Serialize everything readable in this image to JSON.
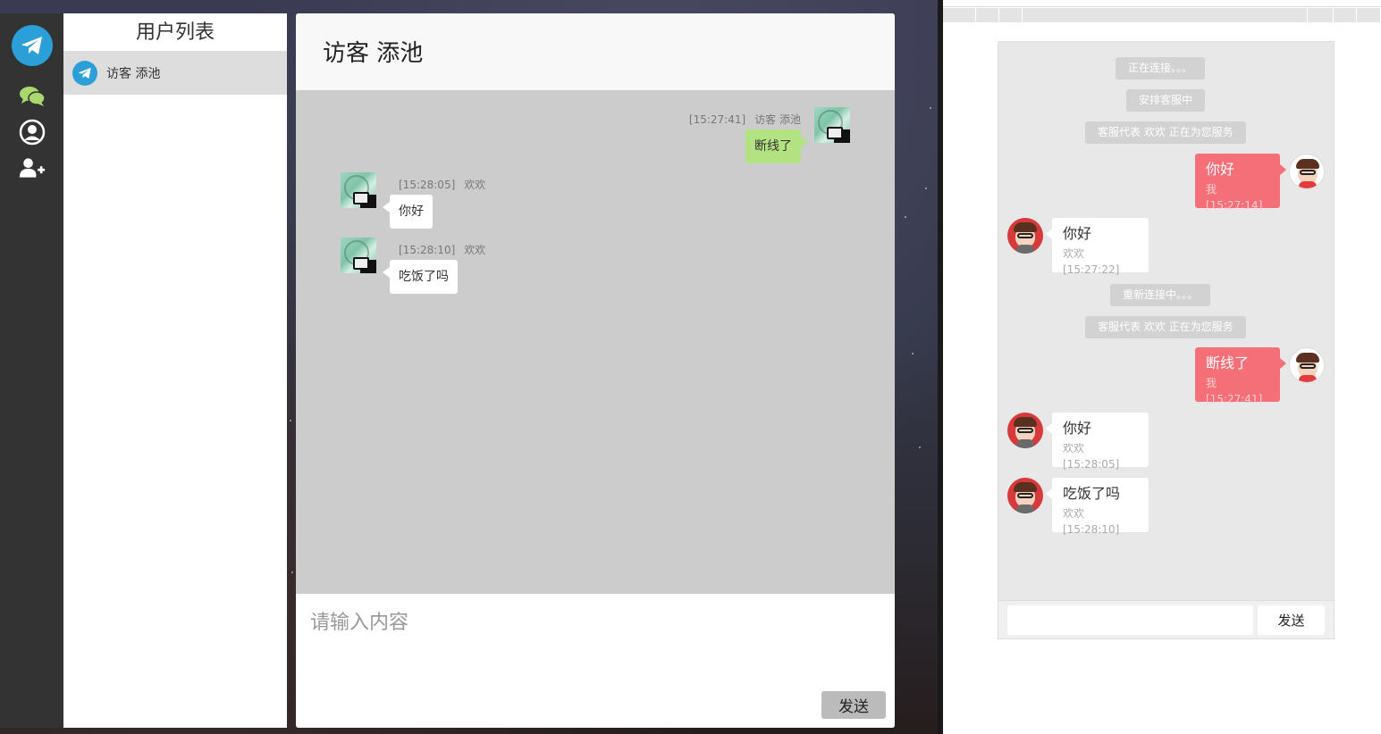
{
  "sidebar": {
    "icons": [
      "telegram-logo-icon",
      "chat-icon",
      "user-circle-icon",
      "add-user-icon"
    ]
  },
  "user_list": {
    "title": "用户列表",
    "items": [
      {
        "name": "访客 添池"
      }
    ]
  },
  "chat": {
    "title": "访客 添池",
    "messages": [
      {
        "side": "right",
        "time": "[15:27:41]",
        "sender": "访客 添池",
        "text": "断线了"
      },
      {
        "side": "left",
        "time": "[15:28:05]",
        "sender": "欢欢",
        "text": "你好"
      },
      {
        "side": "left",
        "time": "[15:28:10]",
        "sender": "欢欢",
        "text": "吃饭了吗"
      }
    ],
    "input_placeholder": "请输入内容",
    "send_label": "发送"
  },
  "client": {
    "system_notices": [
      "正在连接。。。",
      "安排客服中",
      "客服代表 欢欢 正在为您服务",
      "重新连接中。。。",
      "客服代表 欢欢 正在为您服务"
    ],
    "messages": [
      {
        "side": "mine",
        "text": "你好",
        "stamp": "我[15:27:14]"
      },
      {
        "side": "theirs",
        "text": "你好",
        "stamp": "欢欢[15:27:22]"
      },
      {
        "side": "mine",
        "text": "断线了",
        "stamp": "我[15:27:41]"
      },
      {
        "side": "theirs",
        "text": "你好",
        "stamp": "欢欢[15:28:05]"
      },
      {
        "side": "theirs",
        "text": "吃饭了吗",
        "stamp": "欢欢[15:28:10]"
      }
    ],
    "input_value": "",
    "send_label": "发送"
  },
  "colors": {
    "nav_bg": "#333333",
    "accent_blue": "#2a9fd8",
    "mine_bubble": "#f56f78",
    "agent_bubble_green": "#b2e281"
  }
}
